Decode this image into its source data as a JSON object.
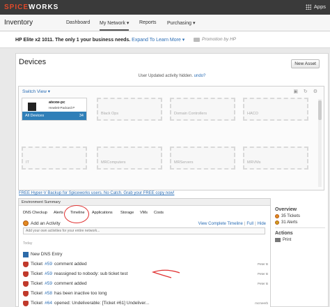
{
  "header": {
    "logo_left": "SPICE",
    "logo_right": "WORKS",
    "apps_label": "Apps"
  },
  "nav": {
    "title": "Inventory",
    "items": [
      "Dashboard",
      "My Network ▾",
      "Reports",
      "Purchasing ▾"
    ]
  },
  "promo": {
    "text": "HP Elite x2 1011. The only 1 your business needs.",
    "link": "Expand To Learn More ▾",
    "by": "Promotion by HP"
  },
  "devices": {
    "title": "Devices",
    "new_asset": "New Asset",
    "notice_text": "User Updated activity hidden.",
    "notice_undo": "undo?",
    "switch_view": "Switch View ▾",
    "panel_icons": "▣ ↻ ⚙",
    "active_tile": {
      "name": "atexw-pc",
      "vendor": "Hewlett-Packard P",
      "label": "All Devices",
      "count": "34"
    },
    "groups": [
      "Black Ops",
      "Domain Controllers",
      "HACO",
      "IT",
      "MRComputers",
      "MRServers",
      "MRVMs"
    ],
    "backup_link": "FREE Hyper-V Backup for Spiceworks users. No Catch. Grab your FREE copy now!"
  },
  "env": {
    "title": "Environment Summary",
    "tabs": [
      "DNS Checkup",
      "Alerts",
      "Timeline",
      "Applications",
      "Storage",
      "VMs",
      "Costs"
    ],
    "add_activity": "Add an Activity",
    "view_timeline": "View Complete Timeline",
    "view_sep1": "|",
    "view_full": "Full",
    "view_sep2": "|",
    "view_hide": "Hide",
    "input_placeholder": "Add your own activities for your entire network...",
    "today": "Today",
    "feed": [
      {
        "icon": "dns-icon",
        "prefix": "New DNS Entry",
        "ticket": "",
        "suffix": "",
        "user": ""
      },
      {
        "icon": "shield-icon",
        "prefix": "Ticket",
        "ticket": "#59",
        "suffix": "comment added",
        "user": "Peter B"
      },
      {
        "icon": "shield-icon",
        "prefix": "Ticket",
        "ticket": "#59",
        "suffix": "reassigned to nobody: sub ticket test",
        "user": "Peter B"
      },
      {
        "icon": "shield-icon",
        "prefix": "Ticket",
        "ticket": "#59",
        "suffix": "comment added",
        "user": "Peter B"
      },
      {
        "icon": "shield-icon",
        "prefix": "Ticket",
        "ticket": "#58",
        "suffix": "has been inactive too long",
        "user": ""
      },
      {
        "icon": "shield-icon",
        "prefix": "Ticket",
        "ticket": "#64",
        "suffix": "opened: Undeliverable: [Ticket #61] Undeliver...",
        "user": "mcmeerb"
      }
    ]
  },
  "overview": {
    "title": "Overview",
    "tickets": "35 Tickets",
    "alerts": "31 Alerts",
    "actions_title": "Actions",
    "print": "Print"
  },
  "colors": {
    "accent": "#2f7fb8",
    "topbar": "#3a3a3a",
    "annotation_red": "#e03030"
  }
}
